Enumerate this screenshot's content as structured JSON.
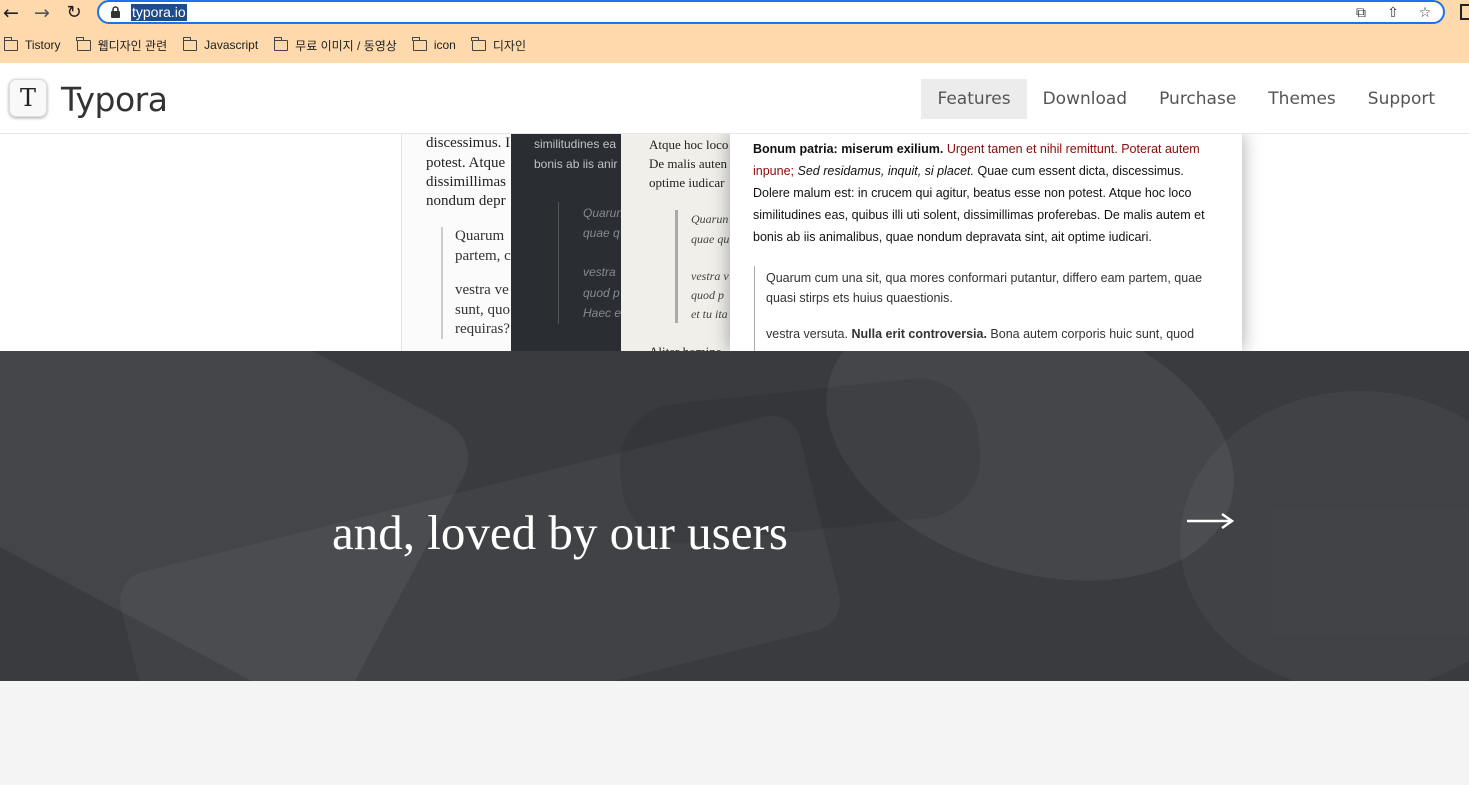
{
  "browser": {
    "url": "typora.io",
    "bookmarks": [
      "Tistory",
      "웹디자인 관련",
      "Javascript",
      "무료 이미지 / 동영상",
      "icon",
      "디자인"
    ]
  },
  "site": {
    "logo_letter": "T",
    "brand": "Typora",
    "nav": [
      {
        "label": "Features",
        "active": true
      },
      {
        "label": "Download",
        "active": false
      },
      {
        "label": "Purchase",
        "active": false
      },
      {
        "label": "Themes",
        "active": false
      },
      {
        "label": "Support",
        "active": false
      }
    ]
  },
  "showcase": {
    "panel1": {
      "lines": [
        "discessimus. I",
        "potest. Atque",
        "dissimillimas",
        "nondum depr"
      ],
      "quote": [
        "Quarum",
        "partem, c",
        "vestra ve",
        "sunt, quo",
        "requiras?"
      ]
    },
    "panel2": {
      "lines": [
        "similitudines ea",
        "bonis ab iis anir"
      ],
      "quote": [
        "Quarun",
        "quae q",
        "vestra",
        "quod p",
        "Haec e"
      ]
    },
    "panel3": {
      "lines": [
        "Atque hoc loco",
        "De malis auten",
        "optime iudicar"
      ],
      "quote": [
        "Quarun",
        "quae qu",
        "vestra v",
        "quod p",
        "et tu ita"
      ],
      "bottom": "Aliter homine"
    },
    "panel4": {
      "bold1": "Bonum patria: miserum exilium.",
      "red": "Urgent tamen et nihil remittunt. Poterat autem inpune;",
      "italic": "Sed residamus, inquit, si placet.",
      "rest": "Quae cum essent dicta, discessimus. Dolere malum est: in crucem qui agitur, beatus esse non potest. Atque hoc loco similitudines eas, quibus illi uti solent, dissimillimas proferebas. De malis autem et bonis ab iis animalibus, quae nondum depravata sint, ait optime iudicari.",
      "quote1": "Quarum cum una sit, qua mores conformari putantur, differo eam partem, quae quasi stirps ets huius quaestionis.",
      "quote2_start": "vestra versuta.",
      "quote2_bold": "Nulla erit controversia.",
      "quote2_rest": "Bona autem corporis huic sunt, quod"
    }
  },
  "hero": {
    "title": "and, loved by our users",
    "arrow": "→"
  }
}
